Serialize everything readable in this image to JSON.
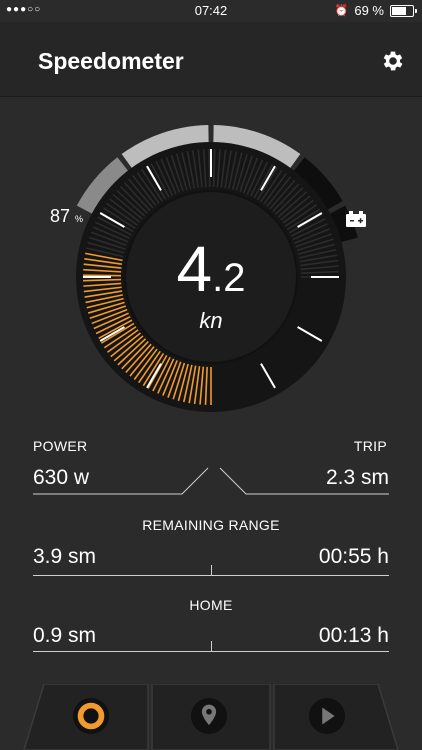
{
  "status_bar": {
    "signal": "●●●○○",
    "time": "07:42",
    "battery_text": "69 %",
    "battery_level": 0.69
  },
  "header": {
    "title": "Speedometer",
    "settings_icon": "gear-icon"
  },
  "gauge": {
    "speed_int": "4",
    "speed_dec": ".2",
    "unit": "kn",
    "power_level_fraction": 0.3,
    "battery_percent": "87",
    "battery_percent_unit": "%",
    "battery_arc_level": 0.87,
    "battery_icon": "battery-charge-icon",
    "accent_color": "#f19a2e"
  },
  "stats": {
    "power": {
      "label": "POWER",
      "value": "630 w"
    },
    "trip": {
      "label": "TRIP",
      "value": "2.3 sm"
    },
    "remaining_range": {
      "label": "REMAINING RANGE",
      "distance": "3.9 sm",
      "time": "00:55 h"
    },
    "home": {
      "label": "HOME",
      "distance": "0.9 sm",
      "time": "00:13 h"
    }
  },
  "tabs": [
    {
      "name": "speedometer",
      "icon": "ring-icon",
      "active": true
    },
    {
      "name": "map",
      "icon": "map-pin-icon",
      "active": false
    },
    {
      "name": "play",
      "icon": "play-icon",
      "active": false
    }
  ]
}
